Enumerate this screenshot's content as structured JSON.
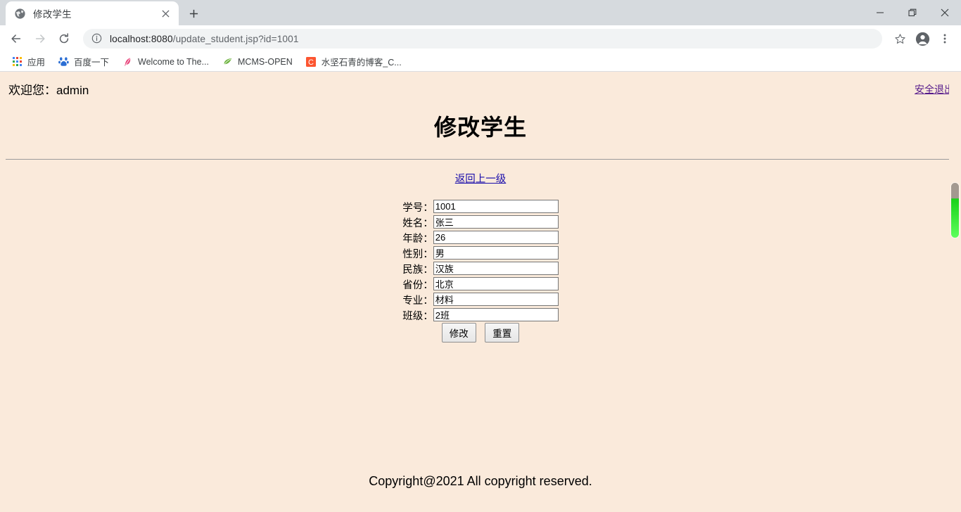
{
  "browser": {
    "tab": {
      "title": "修改学生",
      "favicon": "globe-icon",
      "close": "×"
    },
    "newtab_label": "+",
    "window_controls": {
      "minimize": "—",
      "maximize": "❐",
      "close": "✕"
    },
    "nav": {
      "back": "←",
      "forward": "→",
      "reload": "⟳"
    },
    "omnibox": {
      "info_icon": "info-circle-icon",
      "url_host": "localhost:8080",
      "url_path": "/update_student.jsp?id=1001",
      "url_full": "localhost:8080/update_student.jsp?id=1001"
    },
    "toolbar_icons": {
      "bookmark": "star-icon",
      "profile": "account-icon",
      "menu": "three-dot-menu-icon"
    },
    "bookmarks": [
      {
        "label": "应用",
        "icon": "apps-grid-icon"
      },
      {
        "label": "百度一下",
        "icon": "baidu-icon"
      },
      {
        "label": "Welcome to The...",
        "icon": "feather-icon"
      },
      {
        "label": "MCMS-OPEN",
        "icon": "leaf-icon"
      },
      {
        "label": "水坚石青的博客_C...",
        "icon": "csdn-icon"
      }
    ]
  },
  "page": {
    "welcome": "欢迎您：admin",
    "logout_label": "安全退出",
    "title": "修改学生",
    "back_link": "返回上一级",
    "fields": [
      {
        "label": "学号：",
        "value": "1001",
        "name": "student-id"
      },
      {
        "label": "姓名：",
        "value": "张三",
        "name": "name"
      },
      {
        "label": "年龄：",
        "value": "26",
        "name": "age"
      },
      {
        "label": "性别：",
        "value": "男",
        "name": "gender"
      },
      {
        "label": "民族：",
        "value": "汉族",
        "name": "ethnicity"
      },
      {
        "label": "省份：",
        "value": "北京",
        "name": "province"
      },
      {
        "label": "专业：",
        "value": "材料",
        "name": "major"
      },
      {
        "label": "班级：",
        "value": "2班",
        "name": "class"
      }
    ],
    "buttons": {
      "submit": "修改",
      "reset": "重置"
    },
    "footer": "Copyright@2021 All copyright reserved.",
    "colors": {
      "background": "#faeadb",
      "link": "#1a0dab",
      "visited_link": "#551a8b"
    }
  }
}
